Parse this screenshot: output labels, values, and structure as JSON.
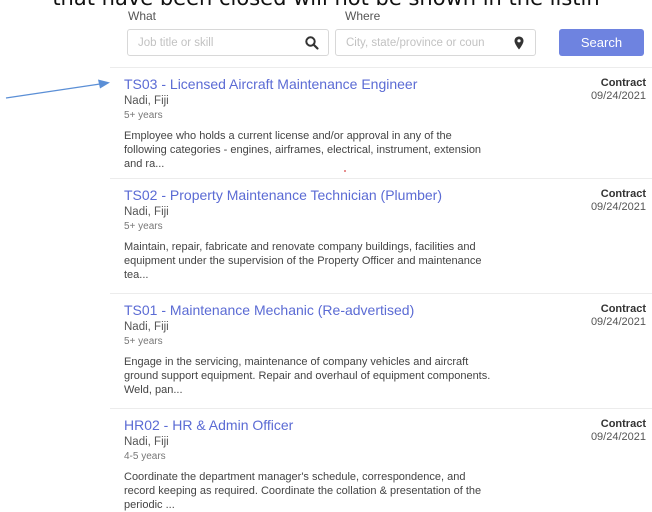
{
  "banner": "that have been closed will not be shown in the listin",
  "search": {
    "what_label": "What",
    "what_placeholder": "Job title or skill",
    "where_label": "Where",
    "where_placeholder": "City, state/province or coun",
    "button_label": "Search"
  },
  "jobs": [
    {
      "title": "TS03 - Licensed Aircraft Maintenance Engineer",
      "location": "Nadi, Fiji",
      "experience": "5+ years",
      "description": "Employee who holds a current license and/or approval in any of the following categories - engines, airframes, electrical, instrument, extension and ra...",
      "type": "Contract",
      "date": "09/24/2021"
    },
    {
      "title": "TS02 - Property Maintenance Technician (Plumber)",
      "location": "Nadi, Fiji",
      "experience": "5+ years",
      "description": "Maintain, repair, fabricate and renovate company buildings, facilities and equipment under the supervision of the Property Officer and maintenance tea...",
      "type": "Contract",
      "date": "09/24/2021"
    },
    {
      "title": "TS01 - Maintenance Mechanic (Re-advertised)",
      "location": "Nadi, Fiji",
      "experience": "5+ years",
      "description": "Engage in the servicing, maintenance of company vehicles and aircraft ground support equipment. Repair and overhaul of equipment components. Weld, pan...",
      "type": "Contract",
      "date": "09/24/2021"
    },
    {
      "title": "HR02 - HR & Admin Officer",
      "location": "Nadi, Fiji",
      "experience": "4-5 years",
      "description": "Coordinate the department manager's schedule, correspondence, and record keeping as required. Coordinate the collation & presentation of the periodic ...",
      "type": "Contract",
      "date": "09/24/2021"
    }
  ],
  "icons": {
    "search": "magnifier-icon",
    "location": "map-pin-icon",
    "pointer": "arrow-icon"
  },
  "colors": {
    "accent": "#6e83e0",
    "title": "#5b6bd4",
    "arrow": "#5b8fd6"
  }
}
